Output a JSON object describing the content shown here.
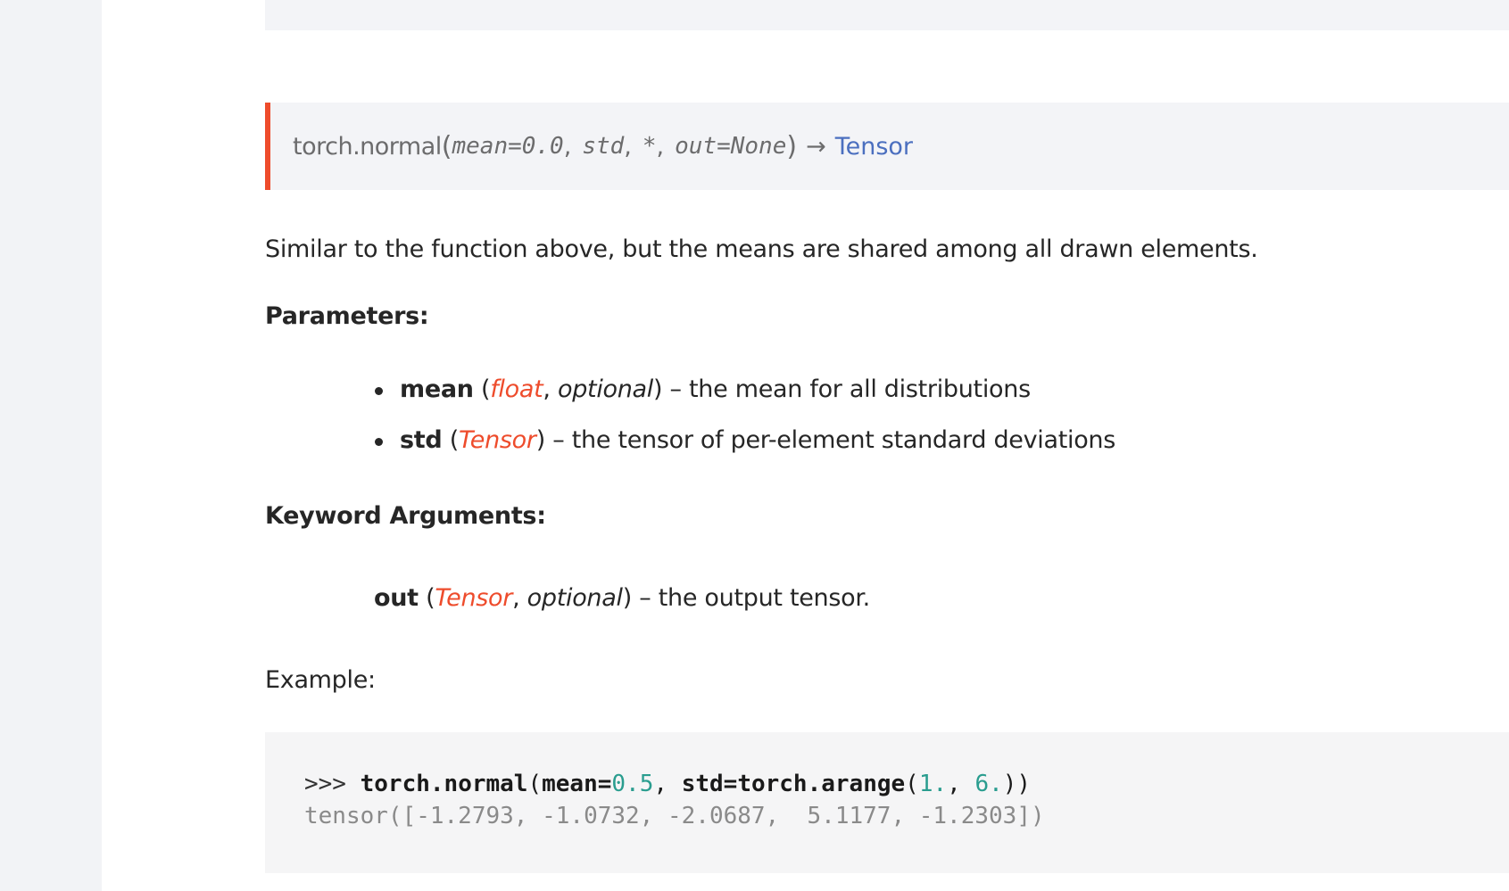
{
  "signature": {
    "name": "torch.normal",
    "params": [
      "mean=0.0",
      "std",
      "*",
      "out=None"
    ],
    "return_type": "Tensor"
  },
  "description": "Similar to the function above, but the means are shared among all drawn elements.",
  "parameters": {
    "heading": "Parameters:",
    "items": [
      {
        "name": "mean",
        "type": "float",
        "optional": "optional",
        "desc": "– the mean for all distributions"
      },
      {
        "name": "std",
        "type": "Tensor",
        "desc": "– the tensor of per-element standard deviations"
      }
    ]
  },
  "keyword_args": {
    "heading": "Keyword Arguments:",
    "item": {
      "name": "out",
      "type": "Tensor",
      "optional": "optional",
      "desc": "– the output tensor."
    }
  },
  "example": {
    "label": "Example:",
    "prompt": ">>> ",
    "call_name": "torch.normal",
    "arg1_name": "mean=",
    "arg1_value": "0.5",
    "arg2_name": "std=",
    "arg2_func": "torch.arange",
    "arange_start": "1.",
    "arange_end": "6.",
    "output": "tensor([-1.2793, -1.0732, -2.0687,  5.1177, -1.2303])"
  },
  "colors": {
    "accent": "#ee4c2c",
    "link": "#4b6fbf",
    "number": "#2a9d8f"
  }
}
